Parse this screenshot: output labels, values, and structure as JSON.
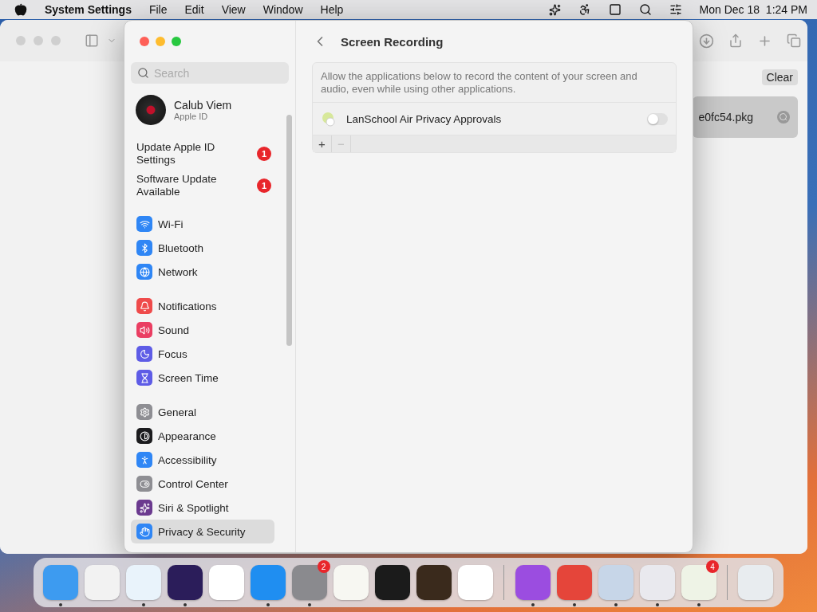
{
  "menu_bar": {
    "app": "System Settings",
    "menus": [
      "File",
      "Edit",
      "View",
      "Window",
      "Help"
    ],
    "clock": "Mon Dec 18  1:24 PM"
  },
  "background_window": {
    "clear_button": "Clear",
    "download": "e0fc54.pkg"
  },
  "settings": {
    "search": {
      "placeholder": "Search"
    },
    "account": {
      "name": "Calub Viem",
      "subtitle": "Apple ID"
    },
    "notices": [
      {
        "label": "Update Apple ID Settings",
        "badge": "1"
      },
      {
        "label": "Software Update Available",
        "badge": "1"
      }
    ],
    "groups": [
      [
        {
          "label": "Wi-Fi",
          "color": "#2f86f5",
          "selected": false
        },
        {
          "label": "Bluetooth",
          "color": "#2f86f5",
          "selected": false
        },
        {
          "label": "Network",
          "color": "#2f86f5",
          "selected": false
        }
      ],
      [
        {
          "label": "Notifications",
          "color": "#ef4b4b",
          "selected": false
        },
        {
          "label": "Sound",
          "color": "#ea3e62",
          "selected": false
        },
        {
          "label": "Focus",
          "color": "#5e5ce6",
          "selected": false
        },
        {
          "label": "Screen Time",
          "color": "#5e5ce6",
          "selected": false
        }
      ],
      [
        {
          "label": "General",
          "color": "#8e8e93",
          "selected": false
        },
        {
          "label": "Appearance",
          "color": "#1c1c1e",
          "selected": false
        },
        {
          "label": "Accessibility",
          "color": "#2f86f5",
          "selected": false
        },
        {
          "label": "Control Center",
          "color": "#8e8e93",
          "selected": false
        },
        {
          "label": "Siri & Spotlight",
          "color": "#6b3a8f",
          "selected": false
        },
        {
          "label": "Privacy & Security",
          "color": "#2f86f5",
          "selected": true
        }
      ]
    ],
    "panel": {
      "title": "Screen Recording",
      "description": "Allow the applications below to record the content of your screen and audio, even while using other applications.",
      "apps": [
        {
          "name": "LanSchool Air Privacy Approvals",
          "on": false
        }
      ],
      "add": "+",
      "remove": "−",
      "remove_disabled": true
    }
  },
  "dock": [
    {
      "color": "#3d9bf0",
      "running": true
    },
    {
      "color": "#f2f2f2",
      "running": false
    },
    {
      "color": "#e9f3fb",
      "running": true
    },
    {
      "color": "#2b1d5a",
      "running": true
    },
    {
      "color": "#ffffff",
      "running": false
    },
    {
      "color": "#1f8ef1",
      "running": true
    },
    {
      "color": "#8a8a8e",
      "running": true,
      "badge": "2"
    },
    {
      "color": "#f7f7f2",
      "running": false
    },
    {
      "color": "#1b1b1b",
      "running": false
    },
    {
      "color": "#3a2a1c",
      "running": false
    },
    {
      "color": "#ffffff",
      "running": false
    },
    {
      "color": "#9b4de0",
      "running": true
    },
    {
      "color": "#e5453a",
      "running": true
    },
    {
      "color": "#c7d6e8",
      "running": true
    },
    {
      "color": "#e9e9ee",
      "running": true
    },
    {
      "color": "#eef3e6",
      "running": true,
      "badge": "4"
    },
    {
      "color": "#e8ecef",
      "running": false
    }
  ]
}
